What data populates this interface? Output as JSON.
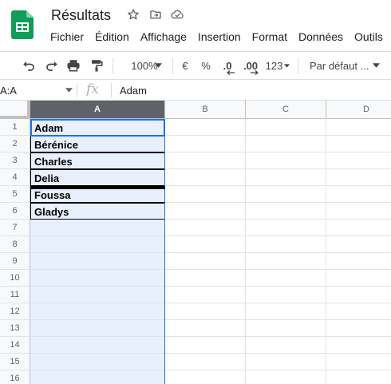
{
  "app": {
    "doc_title": "Résultats",
    "icons": [
      "star-icon",
      "move-to-folder-icon",
      "cloud-status-icon"
    ]
  },
  "menu": [
    "Fichier",
    "Édition",
    "Affichage",
    "Insertion",
    "Format",
    "Données",
    "Outils"
  ],
  "toolbar": {
    "zoom": "100%",
    "currency": "€",
    "percent": "%",
    "decrease_decimals": ".0",
    "increase_decimals": ".00",
    "more_formats": "123",
    "font": "Par défaut ..."
  },
  "formula_bar": {
    "name_box": "A:A",
    "fx": "fx",
    "value": "Adam"
  },
  "grid": {
    "columns": [
      "A",
      "B",
      "C",
      "D"
    ],
    "rows": [
      "1",
      "2",
      "3",
      "4",
      "5",
      "6",
      "7",
      "8",
      "9",
      "10",
      "11",
      "12",
      "13",
      "14",
      "15",
      "16"
    ],
    "col_a_values": [
      "Adam",
      "Bérénice",
      "Charles",
      "Delia",
      "Foussa",
      "Gladys"
    ]
  },
  "colors": {
    "selection_blue": "#1a73e8",
    "selected_fill": "#e8f0fe",
    "sheets_green": "#0f9d58"
  }
}
